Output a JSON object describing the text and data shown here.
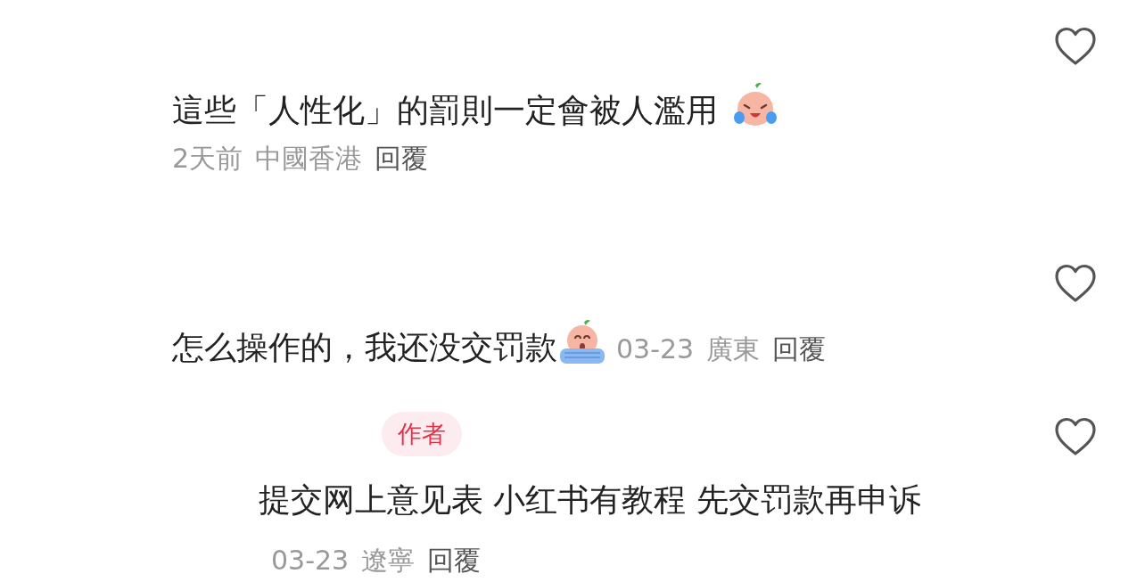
{
  "comments": [
    {
      "kind": "block",
      "text": "這些「人性化」的罰則一定會被人濫用",
      "time": "2天前",
      "location": "中國香港",
      "reply": "回覆"
    },
    {
      "kind": "inline",
      "text": "怎么操作的，我还没交罚款",
      "time": "03-23",
      "location": "廣東",
      "reply": "回覆"
    },
    {
      "kind": "reply",
      "badge": "作者",
      "text": "提交网上意见表 小红书有教程 先交罚款再申诉",
      "time": "03-23",
      "location": "遼寧",
      "reply": "回覆"
    }
  ]
}
